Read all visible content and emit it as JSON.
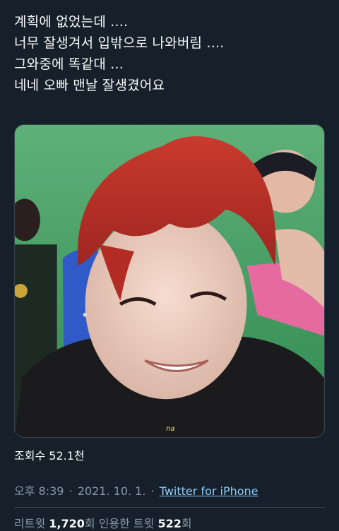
{
  "tweet": {
    "lines": [
      "계획에 없었는데 ....",
      "너무 잘생겨서 입밖으로 나와버림 ....",
      "그와중에 똑같대 ...",
      "네네 오빠 맨날 잘생겼어요"
    ]
  },
  "media": {
    "subtitle": "na"
  },
  "views": {
    "label": "조회수",
    "count": "52.1천"
  },
  "meta": {
    "time": "오후 8:39",
    "separator": "·",
    "date": "2021. 10. 1.",
    "source": "Twitter for iPhone"
  },
  "stats": {
    "retweets_label": "리트윗",
    "retweets_count": "1,720",
    "retweets_unit": "회",
    "quotes_label": "인용한 트윗",
    "quotes_count": "522",
    "quotes_unit": "회"
  },
  "colors": {
    "background": "#15202b",
    "text": "#f7f9f9",
    "secondary": "#8b98a5",
    "link": "#8ecdf8"
  }
}
